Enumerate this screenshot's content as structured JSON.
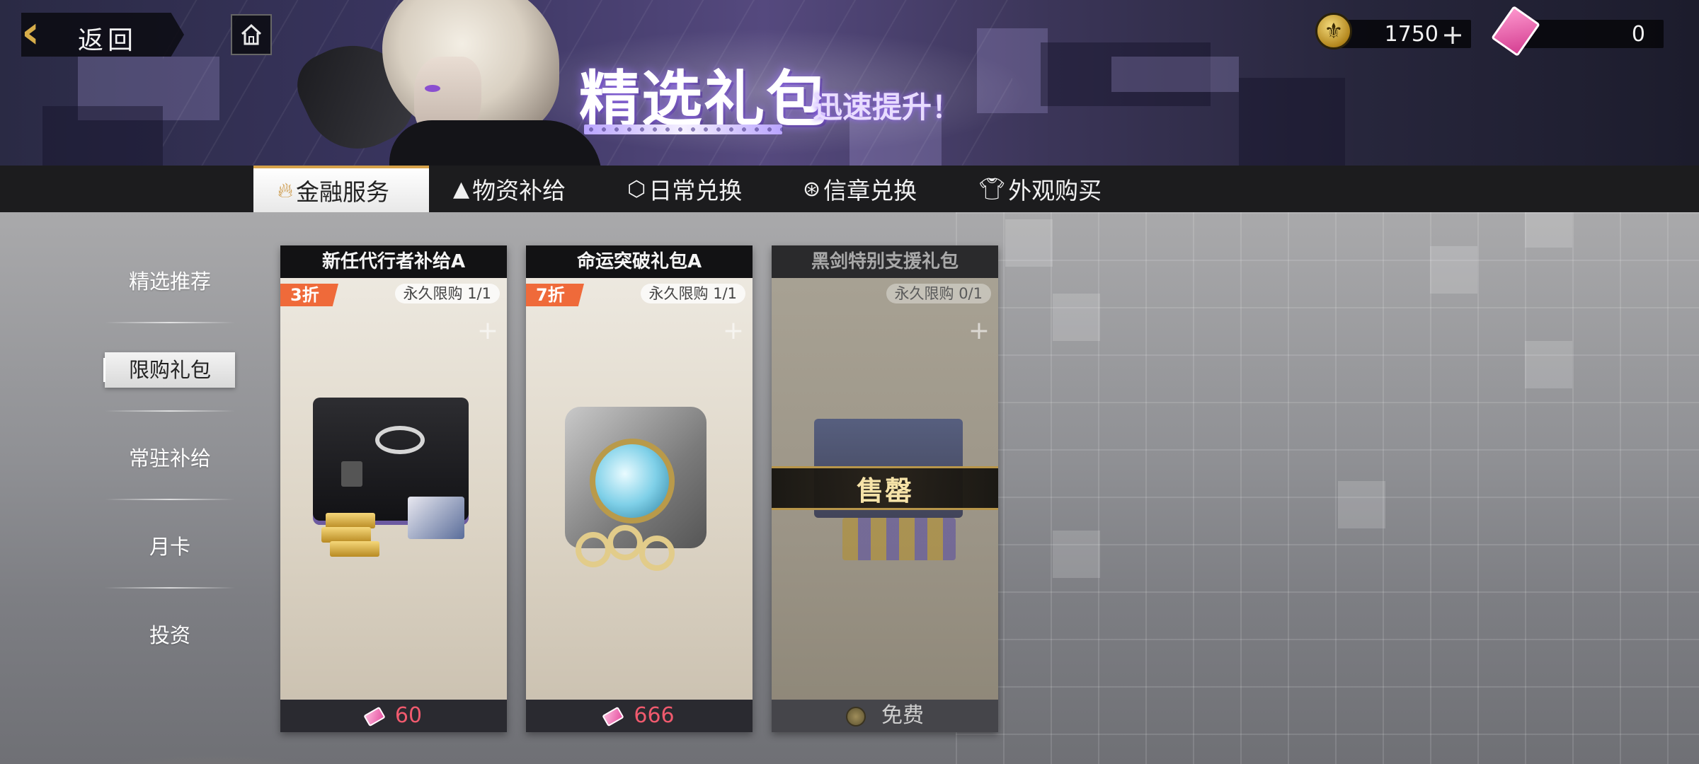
{
  "header": {
    "back_label": "返回",
    "banner_title": "精选礼包",
    "banner_subtitle": "迅速提升！"
  },
  "currency": [
    {
      "icon": "coin-icon",
      "value": "1750",
      "plus": "+"
    },
    {
      "icon": "ticket-icon",
      "value": "0"
    }
  ],
  "tabs": [
    {
      "label": "金融服务",
      "icon": "flame-icon",
      "active": true
    },
    {
      "label": "物资补给",
      "icon": "supply-icon",
      "active": false
    },
    {
      "label": "日常兑换",
      "icon": "cube-icon",
      "active": false
    },
    {
      "label": "信章兑换",
      "icon": "badge-icon",
      "active": false
    },
    {
      "label": "外观购买",
      "icon": "shirt-icon",
      "active": false
    }
  ],
  "sidebar": {
    "items": [
      {
        "label": "精选推荐",
        "active": false
      },
      {
        "label": "限购礼包",
        "active": true
      },
      {
        "label": "常驻补给",
        "active": false
      },
      {
        "label": "月卡",
        "active": false
      },
      {
        "label": "投资",
        "active": false
      }
    ]
  },
  "cards": [
    {
      "title": "新任代行者补给A",
      "discount": "3折",
      "limit": "永久限购 1/1",
      "price": "60",
      "price_icon": "ticket-icon",
      "sold_out": false
    },
    {
      "title": "命运突破礼包A",
      "discount": "7折",
      "limit": "永久限购 1/1",
      "price": "666",
      "price_icon": "ticket-icon",
      "sold_out": false
    },
    {
      "title": "黑剑特别支援礼包",
      "discount": "",
      "limit": "永久限购 0/1",
      "price": "免费",
      "price_icon": "coin-icon",
      "sold_out": true,
      "sold_out_label": "售罄"
    }
  ],
  "colors": {
    "tab_bar": "#1c1c1e",
    "discount_badge": "#ef6a3a",
    "price_text": "#f05a6e",
    "accent_gold": "#d6a24a"
  }
}
